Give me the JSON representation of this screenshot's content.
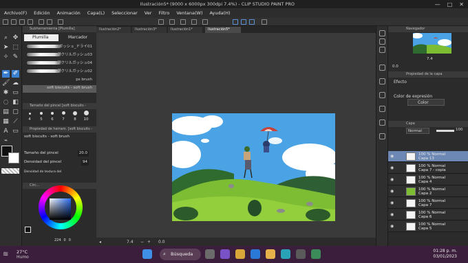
{
  "window": {
    "title": "Ilustración5* (9000 x 6000px 300dpi 7.4%) - CLIP STUDIO PAINT PRO",
    "min": "—",
    "max": "□",
    "close": "✕"
  },
  "menu": [
    "Archivo(F)",
    "Edición",
    "Animación",
    "Capa(L)",
    "Seleccionar",
    "Ver",
    "Filtro",
    "Ventana(W)",
    "Ayuda(H)"
  ],
  "doc_tabs": [
    "Ilustración2*",
    "Ilustración3*",
    "Ilustración1*",
    "Ilustración5*"
  ],
  "left_panel": {
    "subtool_header": "Subherramienta [Plumilla]",
    "tabs": [
      "Plumilla",
      "Marcador"
    ],
    "brushes": [
      {
        "name": "ガッシュ_ドライ01"
      },
      {
        "name": "アクリルガッシュ03"
      },
      {
        "name": "アクリルガッシュ04"
      },
      {
        "name": "アクリルガッシュ02"
      },
      {
        "name": "ps brush"
      },
      {
        "name": "soft biscuits - soft brush"
      }
    ],
    "brush_size_header": "Tamaño del pincel [soft biscuits -",
    "brush_sizes": [
      "4",
      "5",
      "6",
      "7",
      "8",
      "10"
    ],
    "tool_prop_header": "Propiedad de herram. [soft biscuits -",
    "tool_prop_name": "soft biscuits - soft brush",
    "props": [
      {
        "label": "Tamaño del pincel",
        "value": "20.0"
      },
      {
        "label": "Densidad del pincel",
        "value": "94"
      },
      {
        "label": "Densidad de textura del",
        "value": ""
      }
    ],
    "color_header": "Círc...",
    "color_values": [
      "224",
      "0",
      "0"
    ]
  },
  "canvas_status": {
    "zoom": "7.4",
    "rotation": "0.0"
  },
  "right_panel": {
    "navigator_header": "Navegador",
    "nav_zoom": "7.4",
    "nav_rotation": "0.0",
    "layer_prop_header": "Propiedad de la capa",
    "effect_label": "Efecto",
    "color_expr_label": "Color de expresión",
    "color_expr_value": "Color",
    "layers_header": "Capa",
    "blend_mode": "Normal",
    "opacity": "100",
    "layers": [
      {
        "name": "Capa 13",
        "mode": "100 % Normal",
        "selected": true
      },
      {
        "name": "Capa 7 - copia",
        "mode": "100 % Normal",
        "selected": false
      },
      {
        "name": "Capa 4",
        "mode": "100 % Normal",
        "selected": false
      },
      {
        "name": "Capa 2",
        "mode": "100 % Normal",
        "selected": false
      },
      {
        "name": "Capa 7",
        "mode": "100 % Normal",
        "selected": false
      },
      {
        "name": "Capa 6",
        "mode": "100 % Normal",
        "selected": false
      },
      {
        "name": "Capa 5",
        "mode": "100 % Normal",
        "selected": false
      }
    ]
  },
  "taskbar": {
    "temp": "27°C",
    "weather": "Humo",
    "search": "Búsqueda",
    "time": "01:28 p. m.",
    "date": "03/01/2023"
  },
  "colors": {
    "accent": "#3a7fd0",
    "taskbar": "#3b1e3b",
    "layer_selected": "#6d88b5"
  }
}
